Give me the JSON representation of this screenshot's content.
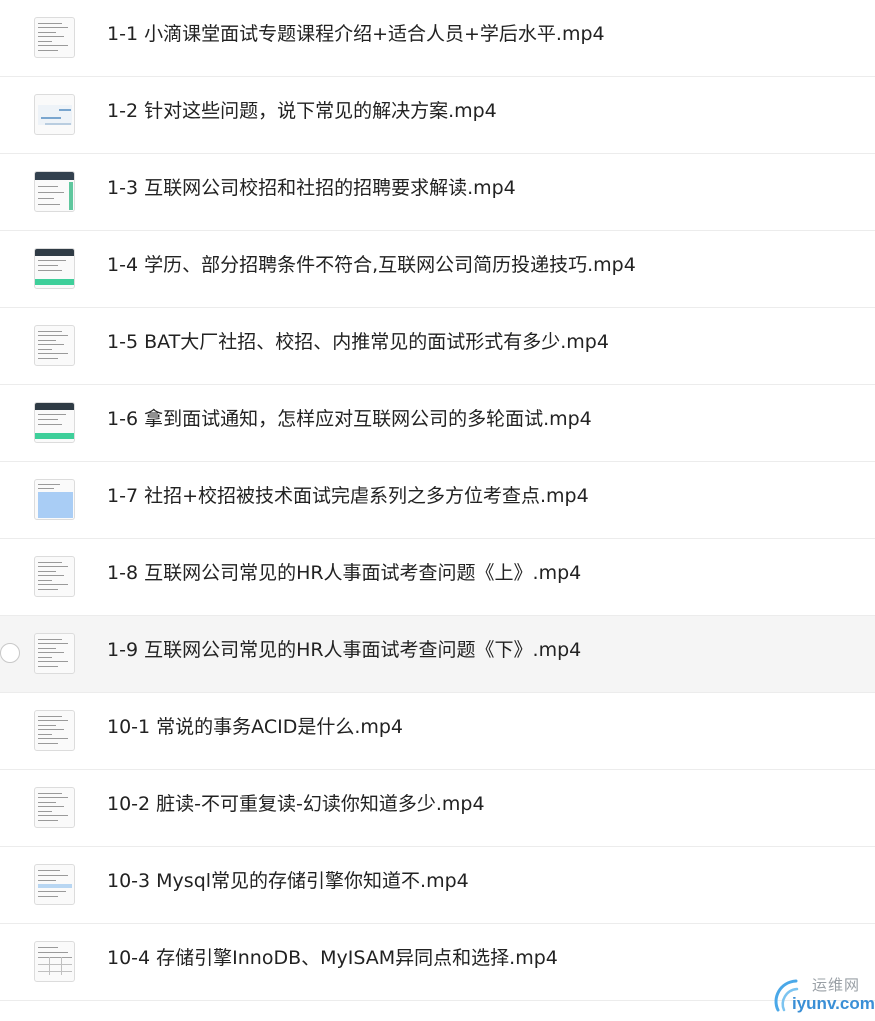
{
  "files": [
    {
      "name": "1-1 小滴课堂面试专题课程介绍+适合人员+学后水平.mp4",
      "thumb": "doc"
    },
    {
      "name": "1-2 针对这些问题，说下常见的解决方案.mp4",
      "thumb": "chart"
    },
    {
      "name": "1-3 互联网公司校招和社招的招聘要求解读.mp4",
      "thumb": "dark-header"
    },
    {
      "name": "1-4 学历、部分招聘条件不符合,互联网公司简历投递技巧.mp4",
      "thumb": "dark-green"
    },
    {
      "name": "1-5 BAT大厂社招、校招、内推常见的面试形式有多少.mp4",
      "thumb": "doc"
    },
    {
      "name": "1-6 拿到面试通知，怎样应对互联网公司的多轮面试.mp4",
      "thumb": "dark-green"
    },
    {
      "name": "1-7 社招+校招被技术面试完虐系列之多方位考查点.mp4",
      "thumb": "blue"
    },
    {
      "name": "1-8 互联网公司常见的HR人事面试考查问题《上》.mp4",
      "thumb": "doc"
    },
    {
      "name": "1-9 互联网公司常见的HR人事面试考查问题《下》.mp4",
      "thumb": "doc",
      "hover": true
    },
    {
      "name": "10-1 常说的事务ACID是什么.mp4",
      "thumb": "doc"
    },
    {
      "name": "10-2 脏读-不可重复读-幻读你知道多少.mp4",
      "thumb": "doc"
    },
    {
      "name": "10-3 Mysql常见的存储引擎你知道不.mp4",
      "thumb": "doc-blue"
    },
    {
      "name": "10-4 存储引擎InnoDB、MyISAM异同点和选择.mp4",
      "thumb": "table"
    }
  ],
  "watermark": {
    "top": "运维网",
    "bottom": "iyunv.com"
  },
  "colors": {
    "hover_row": "#f5f5f5",
    "divider": "#ececec",
    "text": "#222222",
    "accent_green": "#3ecf9a",
    "accent_blue": "#a9cdf5"
  }
}
